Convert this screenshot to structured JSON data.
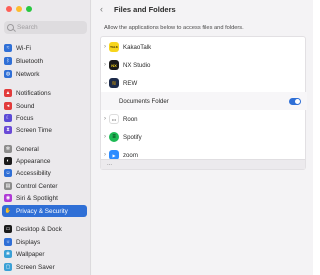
{
  "window": {
    "title": "Files and Folders"
  },
  "search": {
    "placeholder": "Search"
  },
  "sidebar": {
    "items": [
      {
        "label": "Wi-Fi",
        "color": "#2f6fd6",
        "icon": "wifi-icon",
        "glyph": "≈"
      },
      {
        "label": "Bluetooth",
        "color": "#2f6fd6",
        "icon": "bluetooth-icon",
        "glyph": "ᛒ"
      },
      {
        "label": "Network",
        "color": "#2f6fd6",
        "icon": "globe-icon",
        "glyph": "◍"
      },
      {
        "label": "Notifications",
        "color": "#e23b3b",
        "icon": "bell-icon",
        "glyph": "▲"
      },
      {
        "label": "Sound",
        "color": "#e23b3b",
        "icon": "speaker-icon",
        "glyph": "◂"
      },
      {
        "label": "Focus",
        "color": "#5b4ad6",
        "icon": "moon-icon",
        "glyph": "☾"
      },
      {
        "label": "Screen Time",
        "color": "#6a4ad6",
        "icon": "hourglass-icon",
        "glyph": "⧗"
      },
      {
        "label": "General",
        "color": "#8c8c8c",
        "icon": "gear-icon",
        "glyph": "✻"
      },
      {
        "label": "Appearance",
        "color": "#1a1a1a",
        "icon": "appearance-icon",
        "glyph": "◐"
      },
      {
        "label": "Accessibility",
        "color": "#2f6fd6",
        "icon": "accessibility-icon",
        "glyph": "☺"
      },
      {
        "label": "Control Center",
        "color": "#8c8c8c",
        "icon": "control-center-icon",
        "glyph": "▤"
      },
      {
        "label": "Siri & Spotlight",
        "color": "#b03ad6",
        "icon": "siri-icon",
        "glyph": "◉"
      },
      {
        "label": "Privacy & Security",
        "color": "#2f6fd6",
        "icon": "hand-icon",
        "glyph": "✋"
      },
      {
        "label": "Desktop & Dock",
        "color": "#1a1a1a",
        "icon": "dock-icon",
        "glyph": "▭"
      },
      {
        "label": "Displays",
        "color": "#2f6fd6",
        "icon": "display-icon",
        "glyph": "☼"
      },
      {
        "label": "Wallpaper",
        "color": "#3aa0d6",
        "icon": "wallpaper-icon",
        "glyph": "❀"
      },
      {
        "label": "Screen Saver",
        "color": "#3aa0d6",
        "icon": "screen-saver-icon",
        "glyph": "▢"
      }
    ],
    "selected": "Privacy & Security"
  },
  "main": {
    "description": "Allow the applications below to access files and folders.",
    "apps": [
      {
        "name": "KakaoTalk",
        "expanded": false,
        "color": "#f7d51c",
        "icon": "kakaotalk-icon",
        "glyph": "TALK"
      },
      {
        "name": "NX Studio",
        "expanded": false,
        "color": "#1a1a1a",
        "icon": "nx-studio-icon",
        "glyph": "NX"
      },
      {
        "name": "REW",
        "expanded": true,
        "color": "#1c2a4a",
        "icon": "rew-icon",
        "glyph": "≋"
      },
      {
        "name": "Roon",
        "expanded": false,
        "color": "#ffffff",
        "icon": "roon-icon",
        "glyph": "•••"
      },
      {
        "name": "Spotify",
        "expanded": false,
        "color": "#1db954",
        "icon": "spotify-icon",
        "glyph": "≡"
      },
      {
        "name": "zoom",
        "expanded": false,
        "color": "#2d8cff",
        "icon": "zoom-icon",
        "glyph": "▶"
      }
    ],
    "sub_items": [
      {
        "label": "Documents Folder",
        "enabled": true
      }
    ],
    "footer_label": "..."
  }
}
